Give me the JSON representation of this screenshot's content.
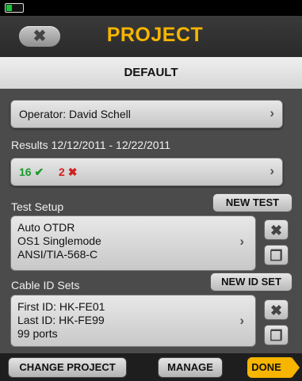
{
  "status": {
    "battery_level": 0.3,
    "battery_color": "#18c23c"
  },
  "header": {
    "back_icon": "close-back-icon",
    "back_glyph": "✖",
    "title": "PROJECT"
  },
  "project": {
    "name": "DEFAULT"
  },
  "operator": {
    "label": "Operator: David Schell"
  },
  "results": {
    "range_label": "Results 12/12/2011 - 12/22/2011",
    "pass_count": "16",
    "pass_glyph": "✔",
    "fail_count": "2",
    "fail_glyph": "✖",
    "pass_color": "#1a9b2a",
    "fail_color": "#d02020"
  },
  "test_setup": {
    "label": "Test Setup",
    "new_button": "NEW TEST",
    "lines": [
      "Auto OTDR",
      "OS1 Singlemode",
      "ANSI/TIA-568-C"
    ]
  },
  "cable_id_sets": {
    "label": "Cable ID Sets",
    "new_button": "NEW ID SET",
    "lines": [
      "First ID: HK-FE01",
      "Last ID: HK-FE99",
      "99 ports"
    ]
  },
  "icons": {
    "delete": "✖",
    "copy": "❐",
    "chevron": "›"
  },
  "footer": {
    "change_project": "CHANGE PROJECT",
    "manage": "MANAGE",
    "done": "DONE"
  },
  "colors": {
    "accent": "#f7b500",
    "background": "#4b4b4b"
  }
}
